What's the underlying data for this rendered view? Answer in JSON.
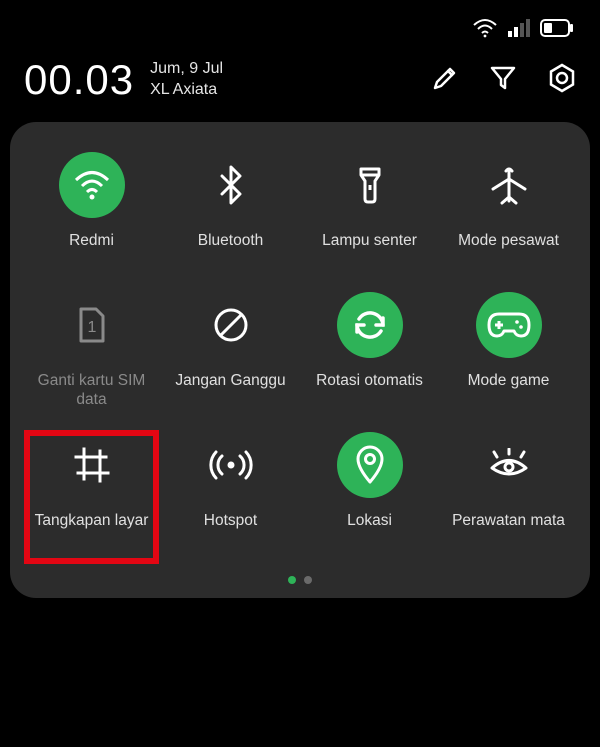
{
  "status": {
    "wifi": "wifi-icon",
    "signal": "signal-icon",
    "battery": "battery-icon"
  },
  "header": {
    "time": "00.03",
    "date": "Jum, 9 Jul",
    "carrier": "XL Axiata"
  },
  "actions": {
    "edit": "edit",
    "filter": "filter",
    "settings": "settings"
  },
  "tiles": [
    {
      "label": "Redmi",
      "active": true
    },
    {
      "label": "Bluetooth",
      "active": false
    },
    {
      "label": "Lampu senter",
      "active": false
    },
    {
      "label": "Mode pesawat",
      "active": false
    },
    {
      "label": "Ganti kartu SIM data",
      "active": false,
      "dim": true
    },
    {
      "label": "Jangan Ganggu",
      "active": false
    },
    {
      "label": "Rotasi otomatis",
      "active": true
    },
    {
      "label": "Mode game",
      "active": true
    },
    {
      "label": "Tangkapan layar",
      "active": false,
      "highlight": true
    },
    {
      "label": "Hotspot",
      "active": false
    },
    {
      "label": "Lokasi",
      "active": true
    },
    {
      "label": "Perawatan mata",
      "active": false
    }
  ],
  "colors": {
    "accent": "#2eb358",
    "panel": "#2c2c2c",
    "highlight": "#e30613"
  }
}
